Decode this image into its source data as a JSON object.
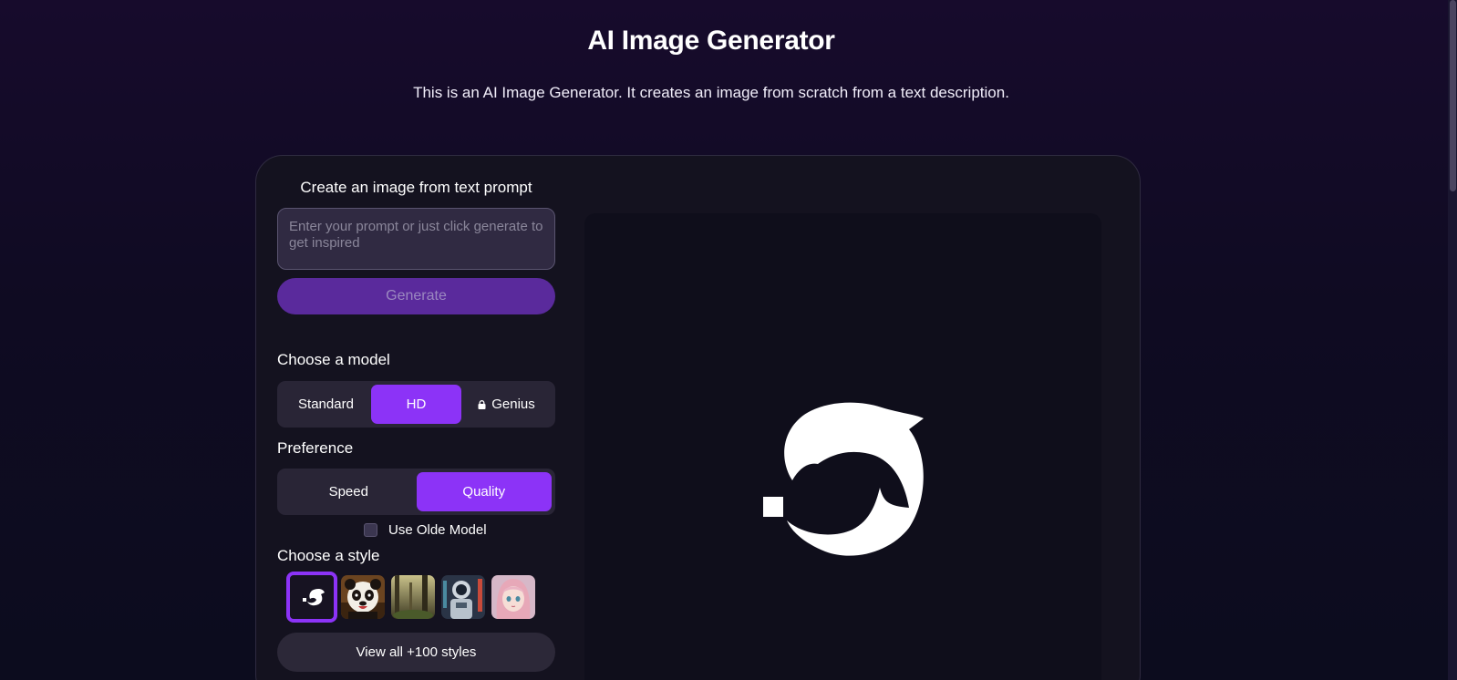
{
  "header": {
    "title": "AI Image Generator",
    "subtitle": "This is an AI Image Generator. It creates an image from scratch from a text description."
  },
  "form": {
    "heading": "Create an image from text prompt",
    "prompt_placeholder": "Enter your prompt or just click generate to get inspired",
    "generate_label": "Generate",
    "model_heading": "Choose a model",
    "models": [
      {
        "label": "Standard",
        "active": false
      },
      {
        "label": "HD",
        "active": true
      },
      {
        "label": "Genius",
        "active": false,
        "locked": true
      }
    ],
    "preference_heading": "Preference",
    "preferences": [
      {
        "label": "Speed",
        "active": false
      },
      {
        "label": "Quality",
        "active": true
      }
    ],
    "old_model_label": "Use Olde Model",
    "style_heading": "Choose a style",
    "styles": [
      "logo",
      "panda",
      "forest",
      "astronaut",
      "anime-girl"
    ],
    "view_all_label": "View all +100 styles"
  },
  "colors": {
    "accent": "#8c33f7",
    "generate_bg": "#5a2a9c",
    "card_bg": "#14121f"
  }
}
